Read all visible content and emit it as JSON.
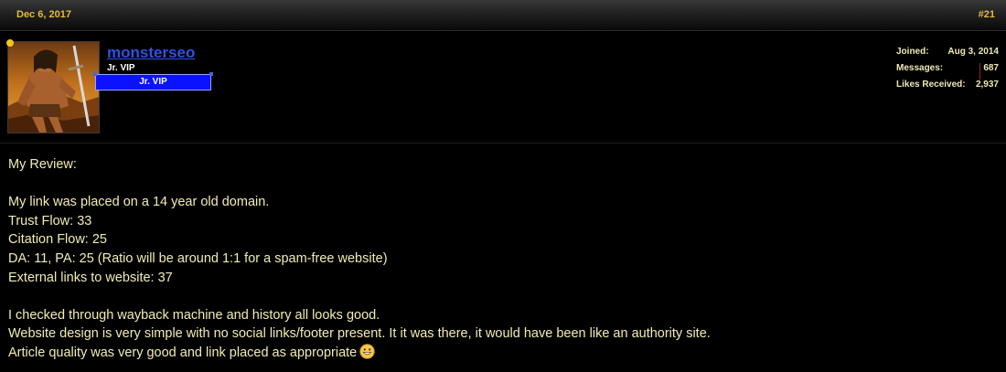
{
  "post": {
    "date": "Dec 6, 2017",
    "number": "#21"
  },
  "user": {
    "name": "monsterseo",
    "title": "Jr. VIP",
    "banner": "Jr. VIP",
    "status": "online",
    "stats": [
      {
        "label": "Joined:",
        "value": "Aug 3, 2014"
      },
      {
        "label": "Messages:",
        "value": "687"
      },
      {
        "label": "Likes Received:",
        "value": "2,937"
      }
    ]
  },
  "message": {
    "lines": [
      "My Review:",
      "",
      "My link was placed on a 14 year old domain.",
      "Trust Flow: 33",
      "Citation Flow: 25",
      "DA: 11, PA: 25 (Ratio will be around 1:1 for a spam-free website)",
      "External links to website: 37",
      "",
      "I checked through wayback machine and history all looks good.",
      "Website design is very simple with no social links/footer present. It it was there, it would have been like an authority site.",
      "Article quality was very good and link placed as appropriate"
    ],
    "smiley": "grin-smiley-icon"
  },
  "colors": {
    "accent_gold": "#e3ba3e",
    "username_blue": "#2d52e6",
    "banner_blue": "#0a12ff",
    "body_text": "#f2ecb2",
    "background": "#000000"
  }
}
